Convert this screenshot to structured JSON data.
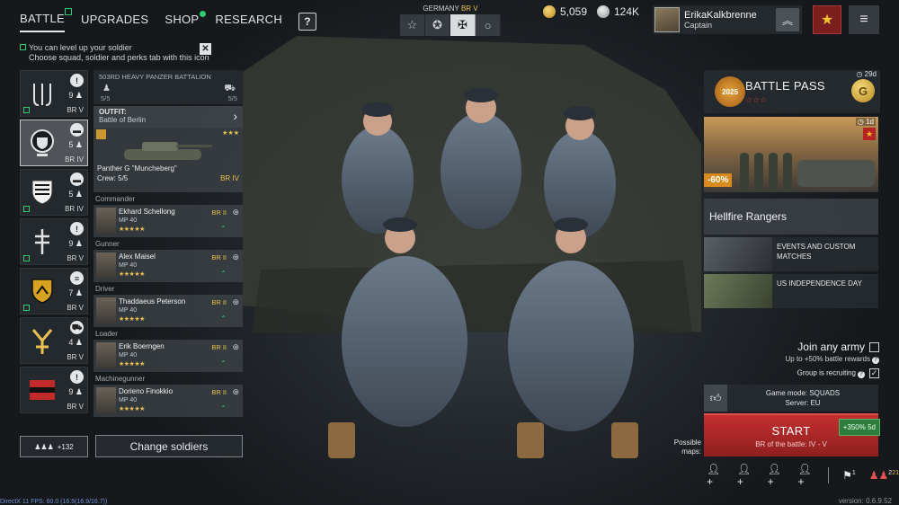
{
  "nav": {
    "tabs": [
      {
        "label": "BATTLE",
        "active": true
      },
      {
        "label": "UPGRADES"
      },
      {
        "label": "SHOP"
      },
      {
        "label": "RESEARCH"
      }
    ],
    "help": "?"
  },
  "tier": {
    "country": "GERMANY",
    "br": "BR V",
    "options": [
      "star-outline-icon",
      "star-circle-icon",
      "iron-cross-icon",
      "circle-icon"
    ],
    "active_index": 2
  },
  "currency": {
    "gold": "5,059",
    "silver": "124K"
  },
  "profile": {
    "name": "ErikaKalkbrenne",
    "rank": "Captain"
  },
  "hint": {
    "line1": "You can level up your soldier",
    "line2": "Choose squad, soldier and perks tab with this icon",
    "close": "✕"
  },
  "squads": [
    {
      "count": "9",
      "br": "BR V",
      "emblem": "anchor-icon"
    },
    {
      "count": "5",
      "br": "BR IV",
      "emblem": "shield-icon"
    },
    {
      "count": "5",
      "br": "BR IV",
      "emblem": "crest-icon"
    },
    {
      "count": "9",
      "br": "BR V",
      "emblem": "rune-icon"
    },
    {
      "count": "7",
      "br": "BR V",
      "emblem": "yellow-shield-icon"
    },
    {
      "count": "4",
      "br": "BR V",
      "emblem": "fork-icon"
    },
    {
      "count": "9",
      "br": "BR V",
      "emblem": "stripe-icon"
    }
  ],
  "detail": {
    "battalion": "503RD HEAVY PANZER BATTALION",
    "left_value": "5/5",
    "right_value": "5/5",
    "outfit_label": "OUTFIT:",
    "outfit_value": "Battle of Berlin",
    "vehicle_name": "Panther G \"Muncheberg\"",
    "crew": "Crew: 5/5",
    "vehicle_br": "BR IV",
    "vehicle_stars": "★★★"
  },
  "soldiers": [
    {
      "role": "Commander",
      "name": "Ekhard Schellong",
      "weapon": "MP 40",
      "br": "BR II",
      "stars": "★★★★★"
    },
    {
      "role": "Gunner",
      "name": "Alex Maisel",
      "weapon": "MP 40",
      "br": "BR II",
      "stars": "★★★★★"
    },
    {
      "role": "Driver",
      "name": "Thaddaeus Peterson",
      "weapon": "MP 40",
      "br": "BR II",
      "stars": "★★★★★"
    },
    {
      "role": "Loader",
      "name": "Erik Boerngen",
      "weapon": "MP 40",
      "br": "BR II",
      "stars": "★★★★★"
    },
    {
      "role": "Machinegunner",
      "name": "Dorieno Finokkio",
      "weapon": "MP 40",
      "br": "BR II",
      "stars": "★★★★★"
    }
  ],
  "bottom": {
    "reserve": "+132",
    "change_soldiers": "Change soldiers"
  },
  "battle_pass": {
    "title": "BATTLE PASS",
    "days": "29d",
    "stars": "☆☆☆",
    "badge": "2025"
  },
  "promo": {
    "days": "1d",
    "discount": "-60%",
    "title": "Hellfire Rangers"
  },
  "events": [
    {
      "label": "EVENTS AND CUSTOM MATCHES"
    },
    {
      "label": "US INDEPENDENCE DAY"
    }
  ],
  "join": {
    "title": "Join any army",
    "sub": "Up to +50% battle rewards",
    "recruiting": "Group is recruiting"
  },
  "mode": {
    "line1": "Game mode: SQUADS",
    "line2": "Server: EU"
  },
  "start": {
    "label": "START",
    "sub": "BR of the battle: IV - V",
    "boost": "+350% 5d"
  },
  "possible_maps": "Possible maps:",
  "actions": {
    "flags": "1",
    "party_a": "2",
    "party_b": "21"
  },
  "footer": {
    "fps": "DirectX 11 FPS: 60.0 (16.5(16.9/16.7))",
    "version": "version: 0.6.9.52"
  },
  "colors": {
    "accent_green": "#2ecc71",
    "gold": "#e8c152",
    "start_red": "#c42f2f"
  }
}
